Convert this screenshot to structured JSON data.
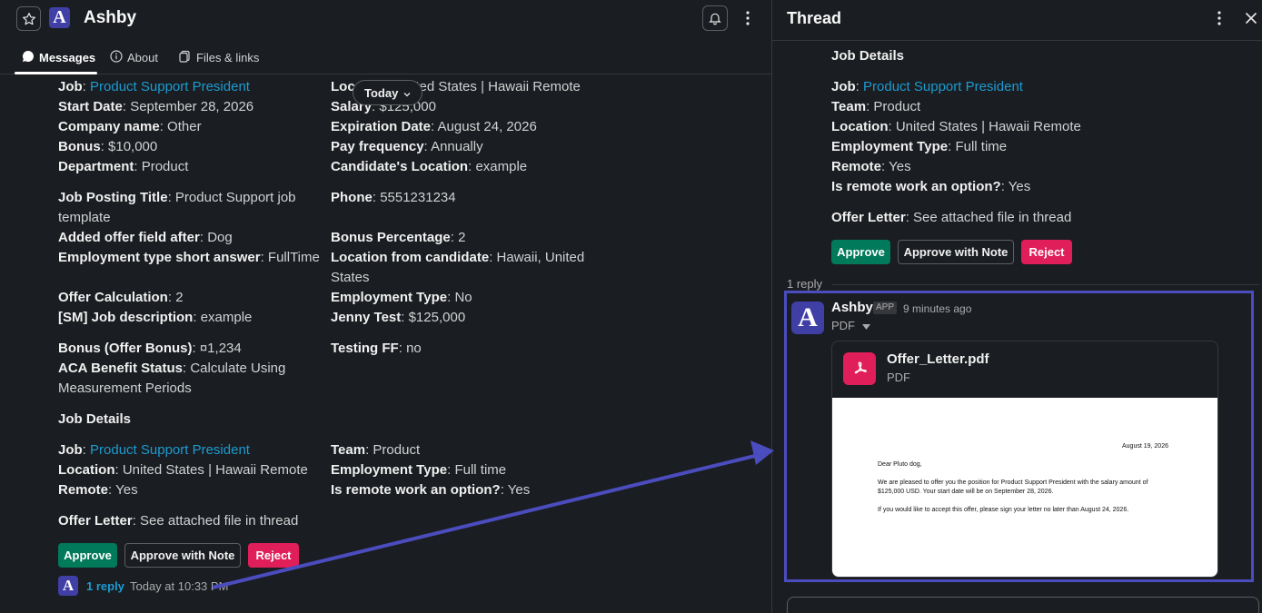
{
  "header": {
    "title": "Ashby",
    "logo_letter": "A",
    "tabs": [
      {
        "label": "Messages"
      },
      {
        "label": "About"
      },
      {
        "label": "Files & links"
      }
    ]
  },
  "date_pill": "Today",
  "message": {
    "col1": [
      {
        "k": "Job",
        "v": "Product Support President",
        "link": true
      },
      {
        "k": "Start Date",
        "v": "September 28, 2026"
      },
      {
        "k": "Company name",
        "v": "Other"
      },
      {
        "k": "Bonus",
        "v": "$10,000"
      },
      {
        "k": "Department",
        "v": "Product"
      },
      {
        "k": "Job Posting Title",
        "v": "Product Support job"
      },
      {
        "k": "",
        "v": "template"
      },
      {
        "k": "Added offer field after",
        "v": "Dog"
      },
      {
        "k": "Employment type short answer",
        "v": "FullTime"
      },
      {
        "k": "Offer Calculation",
        "v": "2"
      },
      {
        "k": "[SM] Job description",
        "v": "example"
      },
      {
        "k": "Bonus (Offer Bonus)",
        "v": "¤1,234"
      },
      {
        "k": "ACA Benefit Status",
        "v": "Calculate Using"
      },
      {
        "k": "",
        "v": "Measurement Periods"
      }
    ],
    "col2": [
      {
        "k": "Location",
        "v": "United States | Hawaii Remote"
      },
      {
        "k": "Salary",
        "v": "$125,000"
      },
      {
        "k": "Expiration Date",
        "v": "August 24, 2026"
      },
      {
        "k": "Pay frequency",
        "v": "Annually"
      },
      {
        "k": "Candidate's Location",
        "v": "example"
      },
      {
        "k": "Phone",
        "v": "5551231234"
      },
      {
        "k": "Bonus Percentage",
        "v": "2"
      },
      {
        "k": "Location from candidate",
        "v": "Hawaii, United"
      },
      {
        "k": "",
        "v": "States"
      },
      {
        "k": "Employment Type",
        "v": "No"
      },
      {
        "k": "Jenny Test",
        "v": "$125,000"
      },
      {
        "k": "Testing FF",
        "v": "no"
      }
    ],
    "job_details_heading": "Job Details",
    "jd_col1": [
      {
        "k": "Job",
        "v": "Product Support President",
        "link": true
      },
      {
        "k": "Location",
        "v": "United States | Hawaii Remote"
      },
      {
        "k": "Remote",
        "v": "Yes"
      }
    ],
    "jd_col2": [
      {
        "k": "Team",
        "v": "Product"
      },
      {
        "k": "Employment Type",
        "v": "Full time"
      },
      {
        "k": "Is remote work an option?",
        "v": "Yes"
      }
    ],
    "offer_letter": {
      "k": "Offer Letter",
      "v": "See attached file in thread"
    },
    "buttons": {
      "approve": "Approve",
      "approve_note": "Approve with Note",
      "reject": "Reject"
    },
    "reply": {
      "count": "1 reply",
      "time": "Today at 10:33 PM"
    }
  },
  "thread": {
    "title": "Thread",
    "heading": "Job Details",
    "fields": [
      {
        "k": "Job",
        "v": "Product Support President",
        "link": true
      },
      {
        "k": "Team",
        "v": "Product"
      },
      {
        "k": "Location",
        "v": "United States | Hawaii Remote"
      },
      {
        "k": "Employment Type",
        "v": "Full time"
      },
      {
        "k": "Remote",
        "v": "Yes"
      },
      {
        "k": "Is remote work an option?",
        "v": "Yes"
      }
    ],
    "offer_letter": {
      "k": "Offer Letter",
      "v": "See attached file in thread"
    },
    "buttons": {
      "approve": "Approve",
      "approve_note": "Approve with Note",
      "reject": "Reject"
    },
    "reply_count": "1 reply",
    "reply": {
      "user": "Ashby",
      "badge": "APP",
      "time": "9 minutes ago",
      "type_label": "PDF",
      "file": {
        "name": "Offer_Letter.pdf",
        "type": "PDF",
        "preview": {
          "date": "August 19, 2026",
          "greeting": "Dear Pluto dog,",
          "line1": "We are pleased to offer you the position for Product Support President with the salary amount of",
          "line2": "$125,000 USD. Your start date will be on September 28, 2026.",
          "line3": "If you would like to accept this offer, please sign your letter no later than August 24, 2026."
        }
      }
    }
  },
  "colors": {
    "accent": "#1d9bd1",
    "approve": "#007a5a",
    "reject": "#e01e5a",
    "highlight": "#4b4cbd"
  }
}
